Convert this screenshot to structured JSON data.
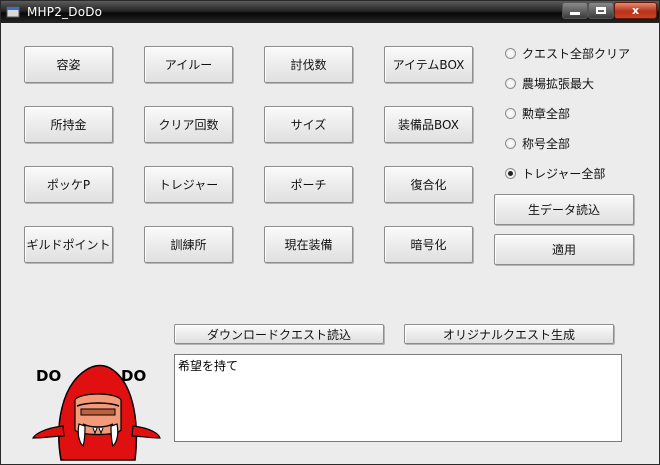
{
  "window": {
    "title": "MHP2_DoDo",
    "close_glyph": "x"
  },
  "buttons": [
    {
      "id": "btn-appearance",
      "label": "容姿"
    },
    {
      "id": "btn-airu",
      "label": "アイルー"
    },
    {
      "id": "btn-hunt-count",
      "label": "討伐数"
    },
    {
      "id": "btn-item-box",
      "label": "アイテムBOX"
    },
    {
      "id": "btn-money",
      "label": "所持金"
    },
    {
      "id": "btn-clear-count",
      "label": "クリア回数"
    },
    {
      "id": "btn-size",
      "label": "サイズ"
    },
    {
      "id": "btn-equip-box",
      "label": "装備品BOX"
    },
    {
      "id": "btn-pokke-point",
      "label": "ポッケP"
    },
    {
      "id": "btn-treasure",
      "label": "トレジャー"
    },
    {
      "id": "btn-pouch",
      "label": "ポーチ"
    },
    {
      "id": "btn-decrypt",
      "label": "復合化"
    },
    {
      "id": "btn-guild-point",
      "label": "ギルドポイント"
    },
    {
      "id": "btn-training",
      "label": "訓練所"
    },
    {
      "id": "btn-current-equip",
      "label": "現在装備"
    },
    {
      "id": "btn-encrypt",
      "label": "暗号化"
    }
  ],
  "options": [
    {
      "label": "クエスト全部クリア",
      "checked": false
    },
    {
      "label": "農場拡張最大",
      "checked": false
    },
    {
      "label": "勲章全部",
      "checked": false
    },
    {
      "label": "称号全部",
      "checked": false
    },
    {
      "label": "トレジャー全部",
      "checked": true
    }
  ],
  "side_buttons": {
    "load_raw": "生データ読込",
    "apply": "適用"
  },
  "bottom_buttons": {
    "load_download_quest": "ダウンロードクエスト読込",
    "create_original_quest": "オリジナルクエスト生成"
  },
  "message_box": {
    "value": "希望を持て"
  },
  "mascot": {
    "left_text": "DO",
    "right_text": "DO"
  }
}
